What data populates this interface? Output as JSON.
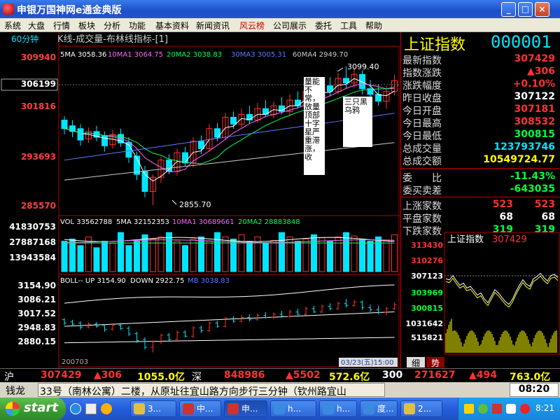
{
  "window": {
    "title": "申银万国神网e通金典版"
  },
  "menu": [
    "系统",
    "大盘",
    "行情",
    "板块",
    "分析",
    "功能",
    "基本资料",
    "新闻资讯",
    "风云榜",
    "公司展示",
    "委托",
    "工具",
    "帮助"
  ],
  "menu_highlight_index": 8,
  "chart": {
    "period": "60分钟",
    "title": "K线-成交量-布林线指标-[1]",
    "ma_legend": [
      {
        "text": "5MA 3058.36",
        "color": "#ffffff"
      },
      {
        "text": "10MA1 3064.75",
        "color": "#ff66ff"
      },
      {
        "text": "20MA2 3038.83",
        "color": "#00ff60"
      },
      {
        "text": "30MA3 3005.31",
        "color": "#5a7aff"
      },
      {
        "text": "60MA4 2949.70",
        "color": "#cccccc"
      }
    ],
    "price_axis": [
      "309940",
      "306199",
      "301816",
      "293693",
      "285570"
    ],
    "high_label": "3099.40",
    "low_label": "2855.70",
    "annotation1": "量能不常，放量顶部十字星严重滞涨，收",
    "annotation2": "三只黑乌鸦",
    "vol_legend": [
      {
        "text": "VOL 33562788",
        "color": "#ffffff"
      },
      {
        "text": "5MA 32152353",
        "color": "#ffffff"
      },
      {
        "text": "10MA1 30689661",
        "color": "#ff66ff"
      },
      {
        "text": "20MA2 28883848",
        "color": "#00ff60"
      }
    ],
    "vol_axis": [
      "41830753",
      "27887168",
      "13943584"
    ],
    "boll_legend": [
      {
        "text": "BOLL-- UP 3154.90",
        "color": "#ffffff"
      },
      {
        "text": "DOWN 2922.75",
        "color": "#ffffff"
      },
      {
        "text": "MB 3038.83",
        "color": "#5a7aff"
      }
    ],
    "boll_axis": [
      "3154.90",
      "3086.21",
      "3017.52",
      "2948.83",
      "2880.15"
    ],
    "x_start_label": "200703",
    "cursor_date": "03/23(五)15:00"
  },
  "index": {
    "name": "上证指数",
    "code": "000001",
    "rows": [
      {
        "label": "最新指数",
        "value": "307429",
        "color": "#ff3232"
      },
      {
        "label": "指数涨跌",
        "value": "▲306",
        "color": "#ff3232"
      },
      {
        "label": "涨跌幅度",
        "value": "+0.10%",
        "color": "#ff3232"
      },
      {
        "label": "昨日收盘",
        "value": "307122",
        "color": "#ffffff"
      },
      {
        "label": "今日开盘",
        "value": "307181",
        "color": "#ff3232"
      },
      {
        "label": "今日最高",
        "value": "308532",
        "color": "#ff3232"
      },
      {
        "label": "今日最低",
        "value": "300815",
        "color": "#00ff40"
      },
      {
        "label": "总成交量",
        "value": "123793746",
        "color": "#00e5ff"
      },
      {
        "label": "总成交额",
        "value": "10549724.77",
        "color": "#ffff00"
      }
    ],
    "rows2": [
      {
        "label": "委　　比",
        "value": "-11.43%",
        "color": "#00ff40"
      },
      {
        "label": "委买卖差",
        "value": "-643035",
        "color": "#00ff40"
      }
    ],
    "rows3": [
      {
        "label": "上涨家数",
        "v1": "523",
        "v2": "523",
        "color": "#ff3232"
      },
      {
        "label": "平盘家数",
        "v1": "68",
        "v2": "68",
        "color": "#ffffff"
      },
      {
        "label": "下跌家数",
        "v1": "319",
        "v2": "319",
        "color": "#00ff40"
      }
    ],
    "mini_title": "上证指数",
    "mini_value": "307429",
    "mini_axis": [
      "313430",
      "310276",
      "307123",
      "303969",
      "300815"
    ],
    "mini_vol_axis": [
      "1031642",
      "515821"
    ],
    "tab_detail": "细",
    "tab_trend": "势"
  },
  "ticker": {
    "sh_label": "沪",
    "sh_value": "307429",
    "sh_change": "▲306",
    "sh_amount": "1055.0亿",
    "sz_label": "深",
    "sz_value": "848986",
    "sz_change": "▲5502",
    "sz_amount": "572.6亿",
    "idx300_label": "300",
    "idx300_value": "271627",
    "idx300_change": "▲494",
    "idx300_amount": "763.0亿"
  },
  "news": {
    "name": "钱龙",
    "text": "33号（南林公寓）二楼，从原址往宜山路方向步行三分钟（钦州路宜山",
    "time": "08:20"
  },
  "taskbar": {
    "start": "start",
    "tasks": [
      "3...",
      "中...",
      "申...",
      "h...",
      "h...",
      "度...",
      "2..."
    ],
    "clock": "8:21"
  }
}
